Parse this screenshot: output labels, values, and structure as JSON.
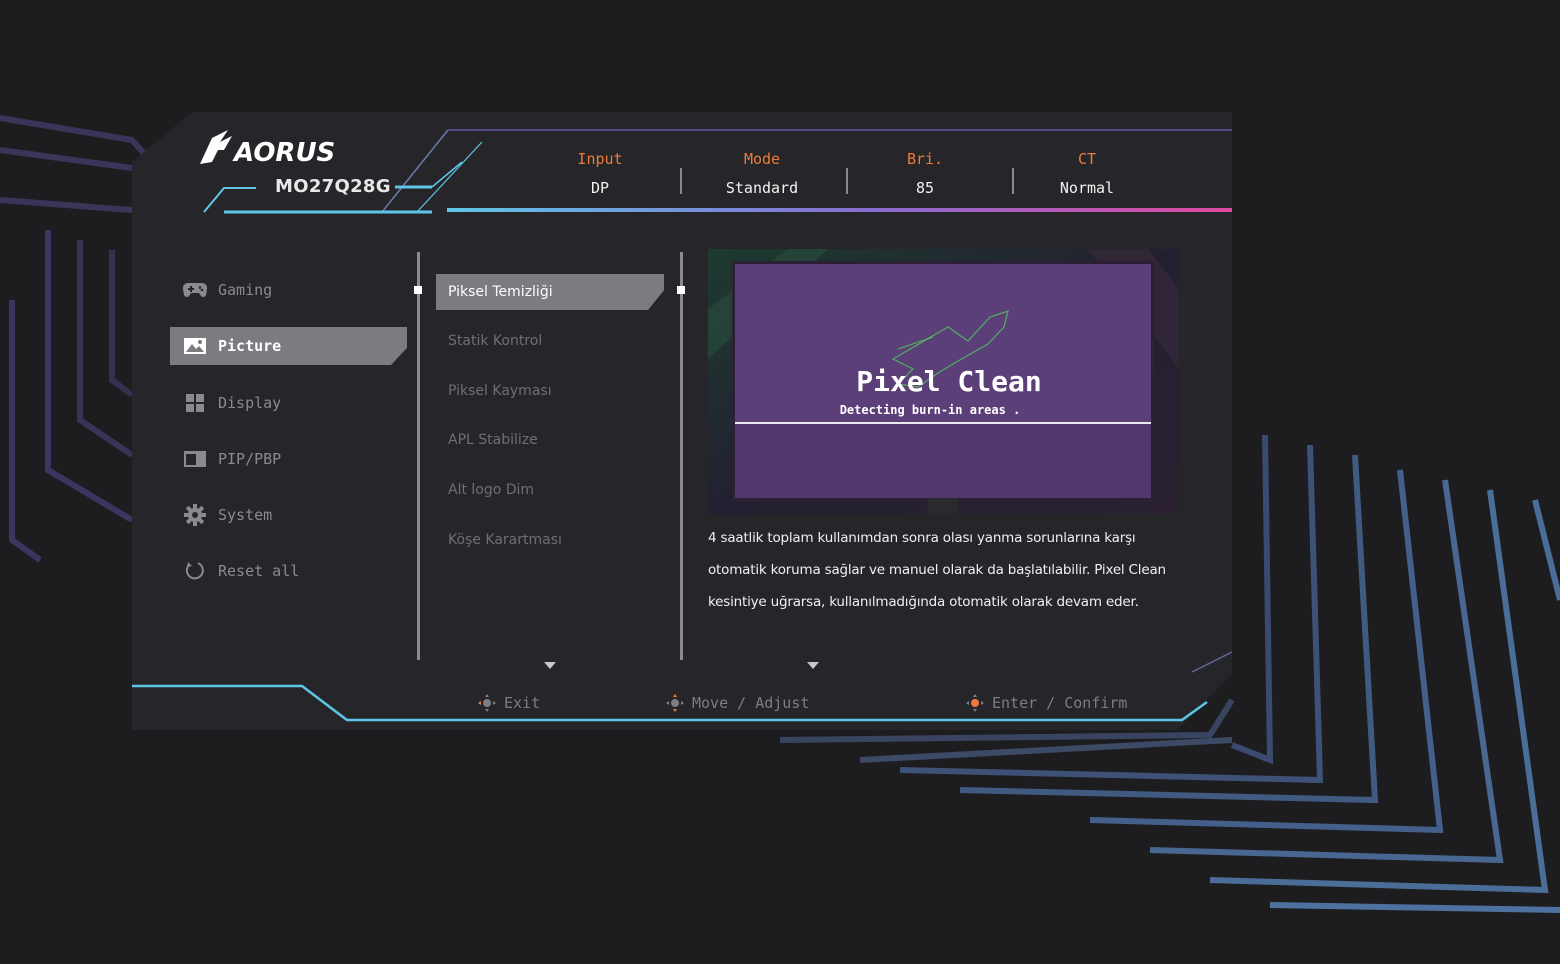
{
  "header": {
    "brand": "AORUS",
    "model": "MO27Q28G",
    "status": [
      {
        "label": "Input",
        "value": "DP"
      },
      {
        "label": "Mode",
        "value": "Standard"
      },
      {
        "label": "Bri.",
        "value": "85"
      },
      {
        "label": "CT",
        "value": "Normal"
      }
    ]
  },
  "menu": {
    "items": [
      {
        "label": "Gaming",
        "icon": "gamepad-icon"
      },
      {
        "label": "Picture",
        "icon": "picture-icon",
        "selected": true
      },
      {
        "label": "Display",
        "icon": "grid-icon"
      },
      {
        "label": "PIP/PBP",
        "icon": "pip-icon"
      },
      {
        "label": "System",
        "icon": "gear-icon"
      },
      {
        "label": "Reset all",
        "icon": "reset-icon"
      }
    ]
  },
  "submenu": {
    "items": [
      {
        "label": "Piksel Temizliği",
        "selected": true
      },
      {
        "label": "Statik Kontrol"
      },
      {
        "label": "Piksel Kayması"
      },
      {
        "label": "APL Stabilize"
      },
      {
        "label": "Alt logo Dim"
      },
      {
        "label": "Köşe Karartması"
      }
    ]
  },
  "preview": {
    "title": "Pixel Clean",
    "subtitle": "Detecting burn-in areas ."
  },
  "description": {
    "lines": [
      "4 saatlik toplam kullanımdan sonra olası yanma sorunlarına karşı",
      "otomatik koruma sağlar ve manuel olarak da başlatılabilir. Pixel Clean",
      "kesintiye uğrarsa, kullanılmadığında otomatik olarak devam eder."
    ]
  },
  "footer": {
    "exit": "Exit",
    "move": "Move / Adjust",
    "enter": "Enter / Confirm"
  },
  "colors": {
    "accent_orange": "#ee7a3a",
    "accent_cyan": "#5fc6e8",
    "accent_pink": "#d04aa0",
    "panel": "#26262a",
    "selected": "#7b7b80"
  }
}
